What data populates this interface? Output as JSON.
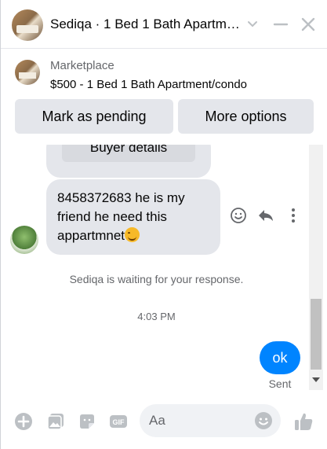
{
  "header": {
    "title": "Sediqa · 1 Bed 1 Bath Apartment/condo",
    "icons": [
      "chevron-down-icon",
      "minimize-icon",
      "close-icon"
    ]
  },
  "marketplace": {
    "label": "Marketplace",
    "listing": "$500 - 1 Bed 1 Bath Apartment/condo",
    "buttons": {
      "pending": "Mark as pending",
      "more": "More options"
    }
  },
  "chat": {
    "buyer_details_label": "Buyer details",
    "message": {
      "text": "8458372683 he is my friend he need this appartmnet",
      "emoji": "smiling-face-emoji"
    },
    "status": "Sediqa is waiting for your response.",
    "timestamp": "4:03 PM",
    "outgoing": {
      "text": "ok",
      "status": "Sent"
    }
  },
  "composer": {
    "placeholder": "Aa",
    "icons": [
      "plus-icon",
      "photo-icon",
      "sticker-icon",
      "gif-icon",
      "emoji-icon",
      "thumbs-up-icon"
    ]
  },
  "colors": {
    "accent": "#0084ff",
    "icon_blue": "#0a7cff",
    "bubble_gray": "#e4e6eb",
    "text_secondary": "#65676b"
  }
}
